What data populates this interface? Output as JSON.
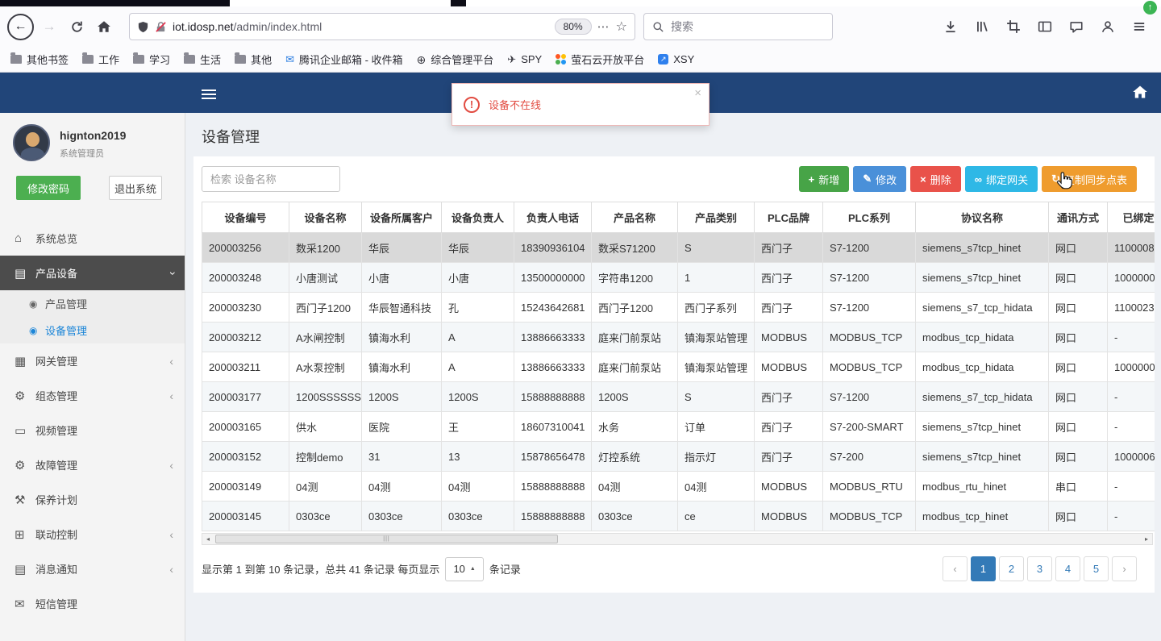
{
  "browser": {
    "toolbar": {
      "url_host": "iot.idosp.net",
      "url_path": "/admin/index.html",
      "zoom_badge": "80%",
      "search_placeholder": "搜索"
    },
    "bookmarks": [
      {
        "name": "other-bookmarks",
        "label": "其他书签",
        "icon": "folder"
      },
      {
        "name": "work",
        "label": "工作",
        "icon": "folder"
      },
      {
        "name": "study",
        "label": "学习",
        "icon": "folder"
      },
      {
        "name": "life",
        "label": "生活",
        "icon": "folder"
      },
      {
        "name": "other",
        "label": "其他",
        "icon": "folder"
      },
      {
        "name": "tencent-exmail",
        "label": "腾讯企业邮箱 - 收件箱",
        "icon": "mail"
      },
      {
        "name": "management-platform",
        "label": "综合管理平台",
        "icon": "globe"
      },
      {
        "name": "spy",
        "label": "SPY",
        "icon": "plane"
      },
      {
        "name": "ys7-open-platform",
        "label": "萤石云开放平台",
        "icon": "dots"
      },
      {
        "name": "xsy",
        "label": "XSY",
        "icon": "square"
      }
    ]
  },
  "alert": {
    "message": "设备不在线"
  },
  "user": {
    "name": "hignton2019",
    "role": "系统管理员",
    "change_password_label": "修改密码",
    "logout_label": "退出系统"
  },
  "sidebar": {
    "items": [
      {
        "name": "system-overview",
        "label": "系统总览",
        "icon": "home",
        "chevron": null,
        "active": false
      },
      {
        "name": "product-device",
        "label": "产品设备",
        "icon": "book",
        "chevron": "down",
        "active": true,
        "children": [
          {
            "name": "product-management",
            "label": "产品管理",
            "active": false
          },
          {
            "name": "device-management",
            "label": "设备管理",
            "active": true
          }
        ]
      },
      {
        "name": "gateway-management",
        "label": "网关管理",
        "icon": "grid",
        "chevron": "left",
        "active": false
      },
      {
        "name": "scada-management",
        "label": "组态管理",
        "icon": "gears",
        "chevron": "left",
        "active": false
      },
      {
        "name": "video-management",
        "label": "视频管理",
        "icon": "monitor",
        "chevron": null,
        "active": false
      },
      {
        "name": "fault-management",
        "label": "故障管理",
        "icon": "gears",
        "chevron": "left",
        "active": false
      },
      {
        "name": "maintenance-plan",
        "label": "保养计划",
        "icon": "wrench",
        "chevron": null,
        "active": false
      },
      {
        "name": "linkage-control",
        "label": "联动控制",
        "icon": "sitemap",
        "chevron": "left",
        "active": false
      },
      {
        "name": "message-notify",
        "label": "消息通知",
        "icon": "book",
        "chevron": "left",
        "active": false
      },
      {
        "name": "sms-management",
        "label": "短信管理",
        "icon": "mail",
        "chevron": null,
        "active": false
      }
    ]
  },
  "page": {
    "title": "设备管理",
    "search_placeholder": "检索 设备名称",
    "toolbar_buttons": [
      {
        "name": "add-button",
        "label": "新增",
        "icon": "plus",
        "color": "#47a447"
      },
      {
        "name": "edit-button",
        "label": "修改",
        "icon": "pencil",
        "color": "#4a90d9"
      },
      {
        "name": "delete-button",
        "label": "删除",
        "icon": "cross",
        "color": "#e9524a"
      },
      {
        "name": "bind-gateway-button",
        "label": "绑定网关",
        "icon": "link",
        "color": "#2eb8e6"
      },
      {
        "name": "copy-sync-table-button",
        "label": "复制同步点表",
        "icon": "sync",
        "color": "#ef9c2e"
      }
    ]
  },
  "table": {
    "headers": [
      "设备编号",
      "设备名称",
      "设备所属客户",
      "设备负责人",
      "负责人电话",
      "产品名称",
      "产品类别",
      "PLC品牌",
      "PLC系列",
      "协议名称",
      "通讯方式",
      "已绑定数"
    ],
    "header_names": [
      "device-id",
      "device-name",
      "customer",
      "owner",
      "phone",
      "product-name",
      "product-category",
      "plc-brand",
      "plc-series",
      "protocol-name",
      "comm-type",
      "bound"
    ],
    "rows": [
      [
        "200003256",
        "数采1200",
        "华辰",
        "华辰",
        "18390936104",
        "数采S71200",
        "S",
        "西门子",
        "S7-1200",
        "siemens_s7tcp_hinet",
        "网口",
        "1100008"
      ],
      [
        "200003248",
        "小唐测试",
        "小唐",
        "小唐",
        "13500000000",
        "字符串1200",
        "1",
        "西门子",
        "S7-1200",
        "siemens_s7tcp_hinet",
        "网口",
        "1000000"
      ],
      [
        "200003230",
        "西门子1200",
        "华辰智通科技",
        "孔",
        "15243642681",
        "西门子1200",
        "西门子系列",
        "西门子",
        "S7-1200",
        "siemens_s7_tcp_hidata",
        "网口",
        "1100023"
      ],
      [
        "200003212",
        "A水闸控制",
        "镇海水利",
        "A",
        "13886663333",
        "庭来门前泵站",
        "镇海泵站管理",
        "MODBUS",
        "MODBUS_TCP",
        "modbus_tcp_hidata",
        "网口",
        "-"
      ],
      [
        "200003211",
        "A水泵控制",
        "镇海水利",
        "A",
        "13886663333",
        "庭来门前泵站",
        "镇海泵站管理",
        "MODBUS",
        "MODBUS_TCP",
        "modbus_tcp_hidata",
        "网口",
        "1000000"
      ],
      [
        "200003177",
        "1200SSSSSS",
        "1200S",
        "1200S",
        "15888888888",
        "1200S",
        "S",
        "西门子",
        "S7-1200",
        "siemens_s7_tcp_hidata",
        "网口",
        "-"
      ],
      [
        "200003165",
        "供水",
        "医院",
        "王",
        "18607310041",
        "水务",
        "订单",
        "西门子",
        "S7-200-SMART",
        "siemens_s7tcp_hinet",
        "网口",
        "-"
      ],
      [
        "200003152",
        "控制demo",
        "31",
        "13",
        "15878656478",
        "灯控系统",
        "指示灯",
        "西门子",
        "S7-200",
        "siemens_s7tcp_hinet",
        "网口",
        "1000006"
      ],
      [
        "200003149",
        "04测",
        "04测",
        "04测",
        "15888888888",
        "04测",
        "04测",
        "MODBUS",
        "MODBUS_RTU",
        "modbus_rtu_hinet",
        "串口",
        "-"
      ],
      [
        "200003145",
        "0303ce",
        "0303ce",
        "0303ce",
        "15888888888",
        "0303ce",
        "ce",
        "MODBUS",
        "MODBUS_TCP",
        "modbus_tcp_hinet",
        "网口",
        "-"
      ]
    ],
    "selected_row_index": 0
  },
  "pagination": {
    "summary_before": "显示第 1 到第 10 条记录，总共 41 条记录 每页显示",
    "page_size": "10",
    "summary_after": "条记录",
    "pages": [
      "1",
      "2",
      "3",
      "4",
      "5"
    ],
    "active_page": "1",
    "prev": "‹",
    "next": "›"
  },
  "icons": {
    "home": "⌂",
    "book": "▤",
    "circle": "◉",
    "grid": "▦",
    "gears": "⚙",
    "monitor": "▭",
    "wrench": "⚒",
    "sitemap": "⊞",
    "mail": "✉",
    "globe": "⊕",
    "plane": "✈",
    "plus": "+",
    "pencil": "✎",
    "cross": "×",
    "link": "∞",
    "sync": "↻",
    "chevron_left": "‹",
    "star": "☆",
    "dots3": "⋯",
    "caret_up": "▲",
    "scroll_left": "◂",
    "scroll_right": "▸",
    "grip": "|||",
    "update_arrow": "↑",
    "back": "←",
    "forward": "→",
    "close": "×",
    "alert_mark": "!",
    "dot_colors": [
      "#ff5722",
      "#ffc107",
      "#4caf50",
      "#2196f3"
    ],
    "square_arrow": "↗"
  }
}
